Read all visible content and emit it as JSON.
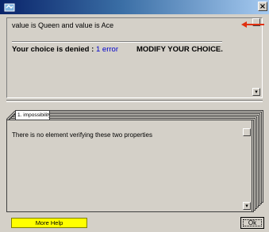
{
  "titlebar": {
    "icon": "app-icon",
    "close_label": "×",
    "close_icon": "close-icon"
  },
  "top_panel": {
    "value_line": "value is Queen and value is Ace",
    "denied_label": "Your choice is denied :",
    "error_count": "1 error",
    "modify_label": "MODIFY YOUR CHOICE."
  },
  "tab": {
    "label": "1. impossibility"
  },
  "bottom_panel": {
    "message": "There is no element verifying these two properties"
  },
  "buttons": {
    "help_label": "More Help",
    "ok_label": "Ok"
  },
  "colors": {
    "titlebar_start": "#0a246a",
    "help_button": "#ffff00",
    "error_text": "#0000cc",
    "arrow": "#e03010"
  }
}
